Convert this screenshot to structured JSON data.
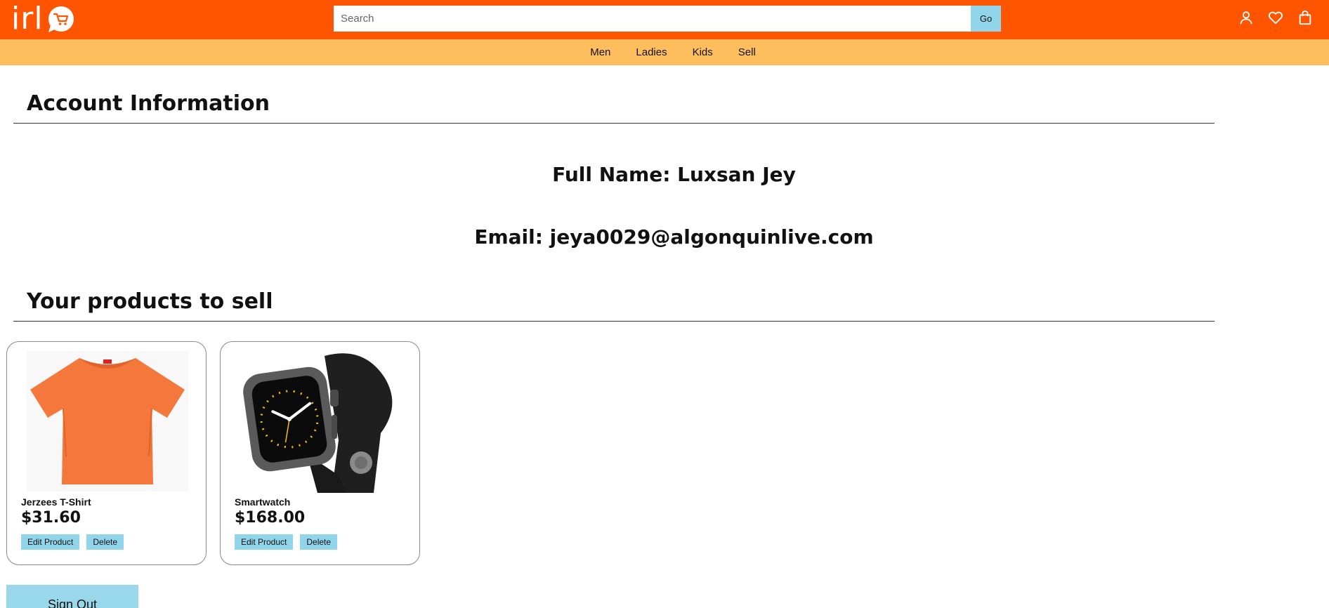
{
  "header": {
    "logo_text": "irl",
    "search": {
      "placeholder": "Search",
      "value": ""
    },
    "go_label": "Go",
    "icons": [
      "user-icon",
      "heart-icon",
      "shopping-bag-icon"
    ],
    "colors": {
      "topbar": "#ff5500",
      "navbar": "#ffbe5e",
      "button": "#90d5ea"
    }
  },
  "nav": {
    "items": [
      {
        "label": "Men"
      },
      {
        "label": "Ladies"
      },
      {
        "label": "Kids"
      },
      {
        "label": "Sell"
      }
    ]
  },
  "account": {
    "title": "Account Information",
    "full_name": "Full Name: Luxsan Jey",
    "email": "Email: jeya0029@algonquinlive.com"
  },
  "products": {
    "title": "Your products to sell",
    "items": [
      {
        "name": "Jerzees T-Shirt",
        "price": "$31.60",
        "image": "orange-tshirt-image",
        "edit_label": "Edit Product",
        "delete_label": "Delete"
      },
      {
        "name": "Smartwatch",
        "price": "$168.00",
        "image": "smartwatch-image",
        "edit_label": "Edit Product",
        "delete_label": "Delete"
      }
    ]
  },
  "signout_label": "Sign Out"
}
